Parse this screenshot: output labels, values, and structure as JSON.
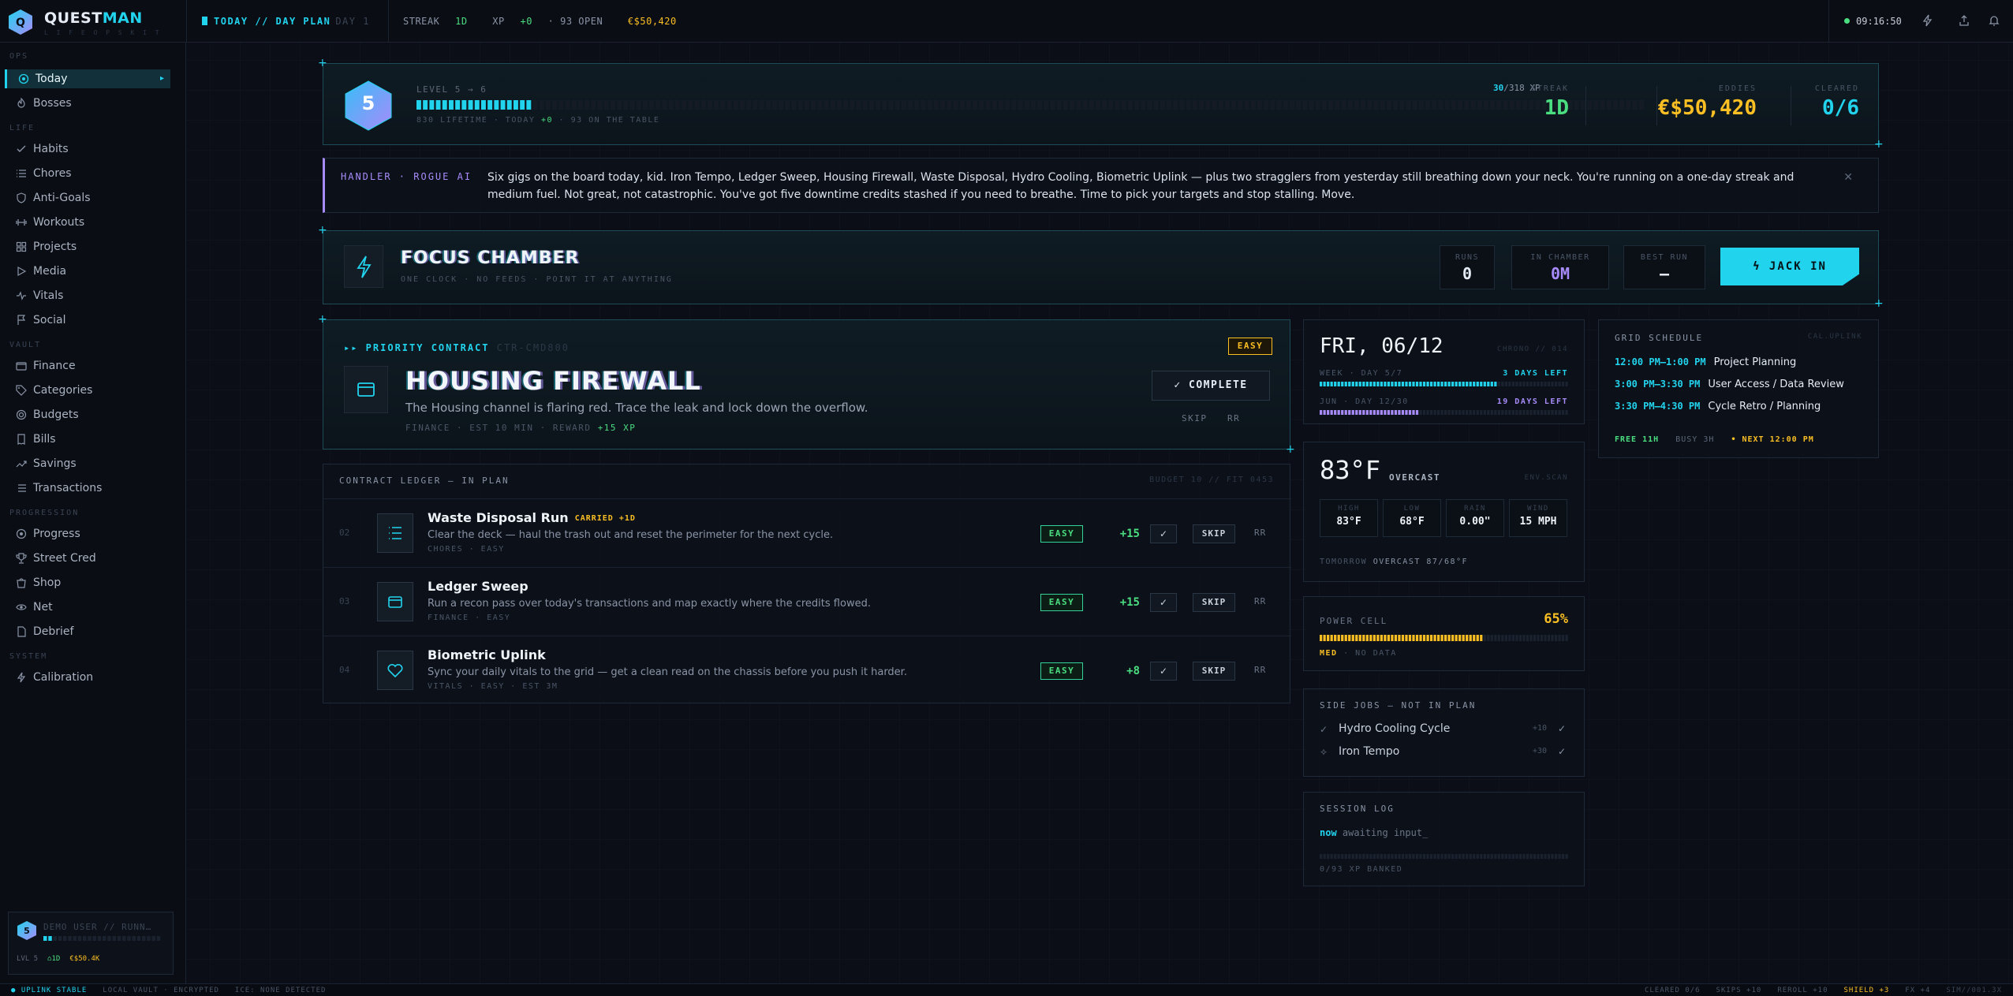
{
  "brand": {
    "name_a": "QUEST",
    "name_b": "MAN",
    "logo_letter": "Q",
    "tagline": "L I F E  O P S  K I T"
  },
  "topbar": {
    "day_tab": "TODAY // DAY PLAN",
    "day_sub": "DAY 1",
    "streak_label": "STREAK",
    "streak_value": "1D",
    "xp_label": "XP",
    "xp_value": "+0",
    "open": "· 93 OPEN",
    "credits": "€$50,420",
    "clock": "09:16:50"
  },
  "sidebar": {
    "sections": [
      {
        "label": "OPS",
        "items": [
          {
            "label": "Today",
            "icon": "target-icon",
            "active": true
          },
          {
            "label": "Bosses",
            "icon": "flame-icon"
          }
        ]
      },
      {
        "label": "LIFE",
        "items": [
          {
            "label": "Habits",
            "icon": "check-icon"
          },
          {
            "label": "Chores",
            "icon": "list-icon"
          },
          {
            "label": "Anti-Goals",
            "icon": "shield-icon"
          },
          {
            "label": "Workouts",
            "icon": "dumbbell-icon"
          },
          {
            "label": "Projects",
            "icon": "grid-icon"
          },
          {
            "label": "Media",
            "icon": "play-icon"
          },
          {
            "label": "Vitals",
            "icon": "pulse-icon"
          },
          {
            "label": "Social",
            "icon": "flag-icon"
          }
        ]
      },
      {
        "label": "VAULT",
        "items": [
          {
            "label": "Finance",
            "icon": "wallet-icon"
          },
          {
            "label": "Categories",
            "icon": "tag-icon"
          },
          {
            "label": "Budgets",
            "icon": "target-icon"
          },
          {
            "label": "Bills",
            "icon": "receipt-icon"
          },
          {
            "label": "Savings",
            "icon": "trend-icon"
          },
          {
            "label": "Transactions",
            "icon": "list-icon"
          }
        ]
      },
      {
        "label": "PROGRESSION",
        "items": [
          {
            "label": "Progress",
            "icon": "target-icon"
          },
          {
            "label": "Street Cred",
            "icon": "trophy-icon"
          },
          {
            "label": "Shop",
            "icon": "bag-icon"
          },
          {
            "label": "Net",
            "icon": "eye-icon"
          },
          {
            "label": "Debrief",
            "icon": "document-icon"
          }
        ]
      },
      {
        "label": "SYSTEM",
        "items": [
          {
            "label": "Calibration",
            "icon": "bolt-icon"
          }
        ]
      }
    ],
    "user": {
      "level": "5",
      "name": "DEMO USER",
      "role": "// RUNN…",
      "lvl_label": "LVL 5",
      "streak": "⌂1D",
      "credits": "€$50.4K",
      "xp_fraction": 0.094
    }
  },
  "level": {
    "num": "5",
    "label": "LEVEL 5 → 6",
    "xp_current": "30",
    "xp_total": "/318 XP",
    "xp_fraction": 0.094,
    "sub": "830 LIFETIME · TODAY",
    "sub_today": "+0",
    "sub_tail": "· 93 ON THE TABLE",
    "kpis": [
      {
        "label": "STREAK",
        "value": "1D",
        "color": "#4ade80"
      },
      {
        "label": "EDDIES",
        "value": "€$50,420",
        "color": "#fbbf24"
      },
      {
        "label": "CLEARED",
        "value": "0/6",
        "color": "#22d3ee"
      }
    ]
  },
  "handler": {
    "tag": "HANDLER · ROGUE AI",
    "text": "Six gigs on the board today, kid. Iron Tempo, Ledger Sweep, Housing Firewall, Waste Disposal, Hydro Cooling, Biometric Uplink — plus two stragglers from yesterday still breathing down your neck. You're running on a one-day streak and medium fuel. Not great, not catastrophic. You've got five downtime credits stashed if you need to breathe. Time to pick your targets and stop stalling. Move."
  },
  "focus": {
    "title": "FOCUS CHAMBER",
    "sub": "ONE CLOCK · NO FEEDS · POINT IT AT ANYTHING",
    "stats": [
      {
        "label": "RUNS",
        "value": "0"
      },
      {
        "label": "IN CHAMBER",
        "value": "0M"
      },
      {
        "label": "BEST RUN",
        "value": "—"
      }
    ],
    "jack_label": "JACK IN"
  },
  "priority": {
    "tag": "▸▸ PRIORITY CONTRACT",
    "tag_id": "CTR-CMD800",
    "difficulty": "EASY",
    "title": "HOUSING FIREWALL",
    "desc": "The Housing channel is flaring red. Trace the leak and lock down the overflow.",
    "meta": "FINANCE · EST 10 MIN · REWARD",
    "reward": "+15 XP",
    "complete_label": "COMPLETE",
    "skip_label": "SKIP",
    "rr_label": "RR"
  },
  "ledger": {
    "title": "CONTRACT LEDGER — IN PLAN",
    "budget": "BUDGET 10 // FIT 0453",
    "rows": [
      {
        "n": "02",
        "icon": "list-icon",
        "title": "Waste Disposal Run",
        "carried": "CARRIED +1D",
        "desc": "Clear the deck — haul the trash out and reset the perimeter for the next cycle.",
        "meta": "CHORES · EASY",
        "difficulty": "EASY",
        "xp": "+15",
        "skip": "SKIP",
        "rr": "RR"
      },
      {
        "n": "03",
        "icon": "wallet-icon",
        "title": "Ledger Sweep",
        "carried": "",
        "desc": "Run a recon pass over today's transactions and map exactly where the credits flowed.",
        "meta": "FINANCE · EASY",
        "difficulty": "EASY",
        "xp": "+15",
        "skip": "SKIP",
        "rr": "RR"
      },
      {
        "n": "04",
        "icon": "heart-icon",
        "title": "Biometric Uplink",
        "carried": "",
        "desc": "Sync your daily vitals to the grid — get a clean read on the chassis before you push it harder.",
        "meta": "VITALS · EASY · EST 3M",
        "difficulty": "EASY",
        "xp": "+8",
        "skip": "SKIP",
        "rr": "RR"
      }
    ]
  },
  "date": {
    "title": "FRI, 06/12",
    "caps": "CHRONO // 014",
    "week_label": "WEEK · DAY 5/7",
    "week_left": "3 DAYS LEFT",
    "week_fraction": 0.71,
    "month_label": "JUN · DAY 12/30",
    "month_left": "19 DAYS LEFT",
    "month_fraction": 0.4
  },
  "weather": {
    "temp": "83°F",
    "cond": "OVERCAST",
    "scan": "ENV.SCAN",
    "stats": [
      {
        "label": "HIGH",
        "value": "83°F"
      },
      {
        "label": "LOW",
        "value": "68°F"
      },
      {
        "label": "RAIN",
        "value": "0.00\""
      },
      {
        "label": "WIND",
        "value": "15 MPH"
      }
    ],
    "tomorrow_label": "TOMORROW",
    "tomorrow": "OVERCAST 87/68°F"
  },
  "power": {
    "label": "POWER CELL",
    "value": "65%",
    "fraction": 0.65,
    "level": "MED",
    "sub": "· NO DATA"
  },
  "sidejobs": {
    "title": "SIDE JOBS — NOT IN PLAN",
    "items": [
      {
        "title": "Hydro Cooling Cycle",
        "xp": "+10",
        "icon": "check-icon"
      },
      {
        "title": "Iron Tempo",
        "xp": "+30",
        "icon": "star-icon"
      }
    ]
  },
  "session": {
    "title": "SESSION LOG",
    "when": "now",
    "text": "awaiting input_",
    "sub": "0/93 XP BANKED",
    "fraction": 0
  },
  "schedule": {
    "title": "GRID SCHEDULE",
    "cal": "CAL.UPLINK",
    "items": [
      {
        "time": "12:00 PM–1:00 PM",
        "title": "Project Planning"
      },
      {
        "time": "3:00 PM–3:30 PM",
        "title": "User Access / Data Review"
      },
      {
        "time": "3:30 PM–4:30 PM",
        "title": "Cycle Retro / Planning"
      }
    ],
    "free": "FREE 11H",
    "busy": "BUSY 3H",
    "next": "• NEXT 12:00 PM"
  },
  "statusbar": {
    "left": [
      "● UPLINK STABLE",
      "LOCAL VAULT · ENCRYPTED",
      "ICE: NONE DETECTED"
    ],
    "right": [
      "CLEARED 0/6",
      "SKIPS +10",
      "REROLL +10",
      "SHIELD +3",
      "FX +4",
      "SIM//001.3X"
    ]
  }
}
